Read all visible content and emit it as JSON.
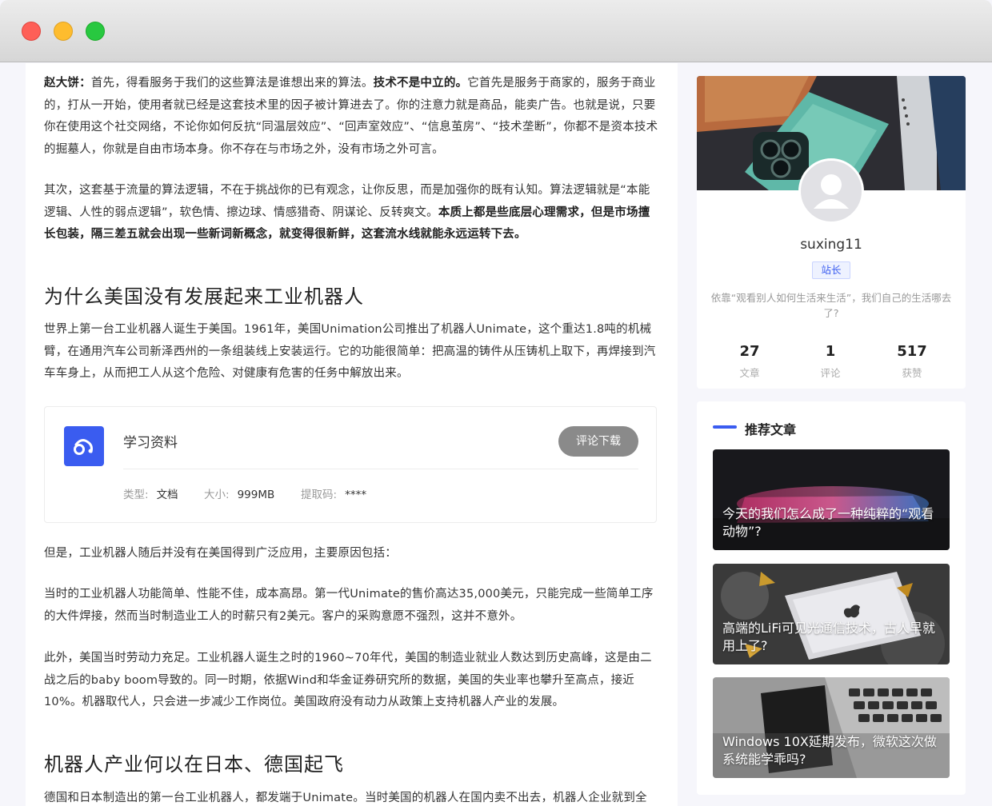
{
  "article": {
    "p1_lead": "赵大饼：",
    "p1_a": "首先，得看服务于我们的这些算法是谁想出来的算法。",
    "p1_bold": "技术不是中立的。",
    "p1_b": "它首先是服务于商家的，服务于商业的，打从一开始，使用者就已经是这套技术里的因子被计算进去了。你的注意力就是商品，能卖广告。也就是说，只要你在使用这个社交网络，不论你如何反抗“同温层效应”、“回声室效应”、“信息茧房”、“技术垄断”，你都不是资本技术的掘墓人，你就是自由市场本身。你不存在与市场之外，没有市场之外可言。",
    "p2_a": "其次，这套基于流量的算法逻辑，不在于挑战你的已有观念，让你反思，而是加强你的既有认知。算法逻辑就是“本能逻辑、人性的弱点逻辑”，软色情、擦边球、情感猎奇、阴谋论、反转爽文。",
    "p2_bold": "本质上都是些底层心理需求，但是市场擅长包装，隔三差五就会出现一些新词新概念，就变得很新鲜，这套流水线就能永远运转下去。",
    "h1": "为什么美国没有发展起来工业机器人",
    "p3": "世界上第一台工业机器人诞生于美国。1961年，美国Unimation公司推出了机器人Unimate，这个重达1.8吨的机械臂，在通用汽车公司新泽西州的一条组装线上安装运行。它的功能很简单：把高温的铸件从压铸机上取下，再焊接到汽车车身上，从而把工人从这个危险、对健康有危害的任务中解放出来。",
    "p4": "但是，工业机器人随后并没有在美国得到广泛应用，主要原因包括：",
    "p5": "当时的工业机器人功能简单、性能不佳，成本高昂。第一代Unimate的售价高达35,000美元，只能完成一些简单工序的大件焊接，然而当时制造业工人的时薪只有2美元。客户的采购意愿不强烈，这并不意外。",
    "p6": "此外，美国当时劳动力充足。工业机器人诞生之时的1960~70年代，美国的制造业就业人数达到历史高峰，这是由二战之后的baby boom导致的。同一时期，依据Wind和华金证券研究所的数据，美国的失业率也攀升至高点，接近10%。机器取代人，只会进一步减少工作岗位。美国政府没有动力从政策上支持机器人产业的发展。",
    "h2": "机器人产业何以在日本、德国起飞",
    "p7": "德国和日本制造出的第一台工业机器人，都发端于Unimate。当时美国的机器人在国内卖不出去，机器人企业就到全"
  },
  "download": {
    "title": "学习资料",
    "button": "评论下载",
    "type_label": "类型:",
    "type_value": "文档",
    "size_label": "大小:",
    "size_value": "999MB",
    "code_label": "提取码:",
    "code_value": "****",
    "icon": "link-cloud-icon",
    "accent": "#3a5cf0"
  },
  "profile": {
    "username": "suxing11",
    "badge": "站长",
    "bio": "依靠“观看别人如何生活来生活”，我们自己的生活哪去了?",
    "stats": [
      {
        "value": "27",
        "label": "文章"
      },
      {
        "value": "1",
        "label": "评论"
      },
      {
        "value": "517",
        "label": "获赞"
      }
    ]
  },
  "recommend": {
    "heading": "推荐文章",
    "items": [
      {
        "title": "今天的我们怎么成了一种纯粹的“观看动物”?"
      },
      {
        "title": "高端的LiFi可见光通信技术，古人早就用上了?"
      },
      {
        "title": "Windows 10X延期发布，微软这次做系统能学乖吗?"
      }
    ]
  }
}
